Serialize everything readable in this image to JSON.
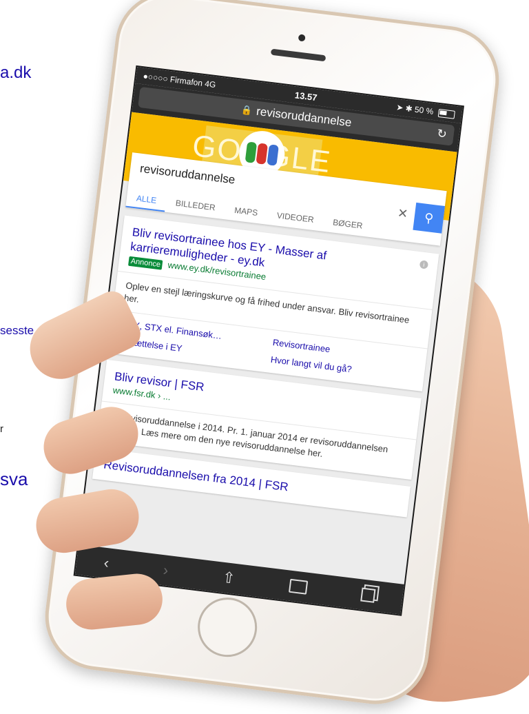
{
  "background_page": {
    "fragments": [
      "a.dk",
      "sesste",
      "r",
      "sva"
    ]
  },
  "status_bar": {
    "carrier": "●○○○○ Firmafon",
    "network": "4G",
    "time": "13.57",
    "battery": "50 %"
  },
  "url_bar": {
    "text": "revisoruddannelse"
  },
  "google": {
    "doodle_text": "GOOGLE",
    "search_value": "revisoruddannelse",
    "tabs": [
      "ALLE",
      "BILLEDER",
      "MAPS",
      "VIDEOER",
      "BØGER"
    ]
  },
  "results": [
    {
      "title": "Bliv revisortrainee hos EY - Masser af karrieremuligheder - ey.dk",
      "ad_label": "Annonce",
      "url": "www.ey.dk/revisortrainee",
      "description": "Oplev en stejl læringskurve og få frihed under ansvar. Bliv revisortrainee her.",
      "sitelinks": [
        "HHX, STX el. Finansøk…",
        "Revisortrainee",
        "Ansættelse i EY",
        "Hvor langt vil du gå?"
      ]
    },
    {
      "title": "Bliv revisor | FSR",
      "url": "www.fsr.dk › ...",
      "description": "Ny revisoruddannelse i 2014. Pr. 1. januar 2014 er revisoruddannelsen ændret. Læs mere om den nye revisoruddannelse her."
    },
    {
      "title": "Revisoruddannelsen fra 2014 | FSR"
    }
  ],
  "toolbar": {
    "back": "‹",
    "forward": "›",
    "share": "⇧"
  },
  "colors": {
    "google_yellow": "#f9bb00",
    "search_blue": "#4285f4",
    "link_blue": "#1a0dab",
    "url_green": "#0a7c33",
    "phone_trim": "#d9c7b2"
  }
}
